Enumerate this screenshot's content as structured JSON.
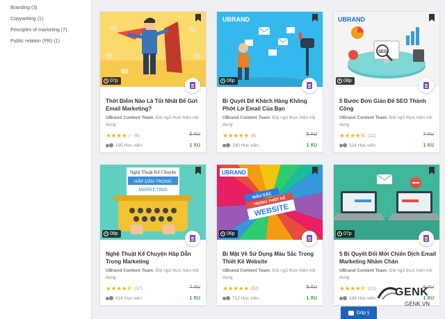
{
  "sidebar": {
    "categories": [
      "Branding (3)",
      "Copywriting (1)",
      "Principles of marketing (7)",
      "Public relation (PR) (1)"
    ]
  },
  "courses": [
    {
      "thumb_brand": "",
      "duration": "07p",
      "title": "Thời Điểm Nào Là Tốt Nhất Để Gửi Email Marketing?",
      "author": "UBrand Content Team",
      "author_desc": ", Đội ngũ thực hiện nội dung",
      "stars": "★★★★☆",
      "rating_value": 4,
      "reviews": "(9)",
      "old_price": "6 XU",
      "students": "195 Học viên",
      "price": "1 XU"
    },
    {
      "thumb_brand": "UBRAND",
      "duration": "06p",
      "title": "Bí Quyết Để Khách Hàng Không Phớt Lờ Email Của Bạn",
      "author": "UBrand Content Team",
      "author_desc": ", Đội ngũ thực hiện nội dung",
      "stars": "★★★★★",
      "rating_value": 5,
      "reviews": "(6)",
      "old_price": "5 XU",
      "students": "190 Học viên",
      "price": "1 XU"
    },
    {
      "thumb_brand": "UBRAND",
      "duration": "08p",
      "title": "5 Bước Đơn Giản Để SEO Thành Công",
      "author": "UBrand Content Team",
      "author_desc": ", Đội ngũ thực hiện nội dung",
      "stars": "★★★★⯪",
      "rating_value": 4.5,
      "reviews": "(22)",
      "old_price": "7 XU",
      "students": "334 Học viên",
      "price": "1 XU"
    },
    {
      "thumb_brand": "",
      "thumb_caption_1": "Nghệ Thuật Kể Chuyện",
      "thumb_caption_2": "HẤP DẪN TRONG",
      "thumb_caption_3": "MARKETING",
      "duration": "08p",
      "title": "Nghệ Thuật Kể Chuyện Hấp Dẫn Trong Marketing",
      "author": "UBrand Content Team",
      "author_desc": ", Đội ngũ thực hiện nội dung",
      "stars": "★★★★⯪",
      "rating_value": 4.5,
      "reviews": "(17)",
      "old_price": "7 XU",
      "students": "416 Học viên",
      "price": "1 XU"
    },
    {
      "thumb_brand": "UBRAND",
      "thumb_caption_1": "MÀU SẮC",
      "thumb_caption_2": "TRONG THIẾT KẾ",
      "thumb_caption_3": "WEBSITE",
      "duration": "06p",
      "title": "Bí Mật Về Sử Dụng Màu Sắc Trong Thiết Kế Website",
      "author": "UBrand Content Team",
      "author_desc": ", Đội ngũ thực hiện nội dung",
      "stars": "★★★★★",
      "rating_value": 5,
      "reviews": "(52)",
      "old_price": "5 XU",
      "students": "712 Học viên",
      "price": "1 XU"
    },
    {
      "thumb_brand": "",
      "duration": "07p",
      "title": "5 Bí Quyết Đổi Mới Chiến Dịch Email Marketing Nhàm Chán",
      "author": "UBrand Content Team",
      "author_desc": ", Đội ngũ thực hiện nội dung",
      "stars": "★★★★⯪",
      "rating_value": 4.5,
      "reviews": "(21)",
      "old_price": "6 XU",
      "students": "336 Học viên",
      "price": "1 XU"
    }
  ],
  "feedback": {
    "label": "Góp ý"
  },
  "watermark": {
    "logo": "GENK",
    "site": "GENK.VN"
  },
  "colors": {
    "star": "#f5b623",
    "price_green": "#2e9c2e",
    "doc_purple": "#7b4fb8",
    "feedback_blue": "#1e63b8"
  }
}
